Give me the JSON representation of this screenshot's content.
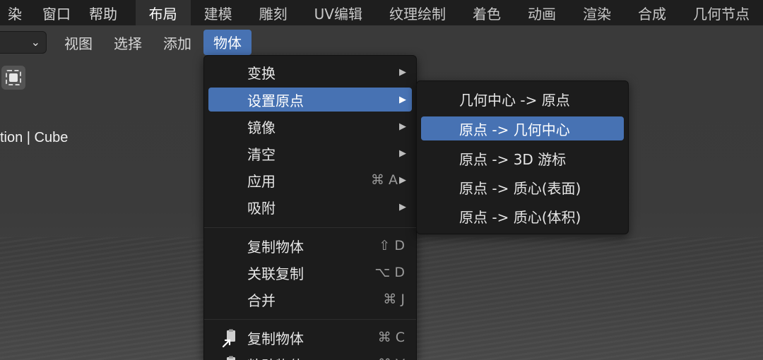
{
  "topbar": {
    "menus": [
      "染",
      "窗口",
      "帮助"
    ],
    "workspaces": [
      "布局",
      "建模",
      "雕刻",
      "UV编辑",
      "纹理绘制",
      "着色",
      "动画",
      "渲染",
      "合成",
      "几何节点"
    ],
    "active_workspace": "布局"
  },
  "viewport": {
    "header_menus": [
      "视图",
      "选择",
      "添加",
      "物体"
    ],
    "active_menu": "物体",
    "object_info": "tion | Cube"
  },
  "object_menu": {
    "items": [
      {
        "label": "变换",
        "shortcut": "",
        "submenu": true
      },
      {
        "label": "设置原点",
        "shortcut": "",
        "submenu": true,
        "highlighted": true
      },
      {
        "label": "镜像",
        "shortcut": "",
        "submenu": true
      },
      {
        "label": "清空",
        "shortcut": "",
        "submenu": true
      },
      {
        "label": "应用",
        "shortcut": "⌘ A",
        "submenu": true
      },
      {
        "label": "吸附",
        "shortcut": "",
        "submenu": true
      },
      {
        "label": "复制物体",
        "shortcut": "⇧ D"
      },
      {
        "label": "关联复制",
        "shortcut": "⌥ D"
      },
      {
        "label": "合并",
        "shortcut": "⌘ J"
      },
      {
        "label": "复制物体",
        "shortcut": "⌘ C",
        "icon": "copy-icon"
      },
      {
        "label": "粘贴物体",
        "shortcut": "⌘ V",
        "icon": "paste-icon"
      }
    ]
  },
  "origin_submenu": {
    "items": [
      {
        "label": "几何中心 -> 原点"
      },
      {
        "label": "原点 -> 几何中心",
        "highlighted": true
      },
      {
        "label": "原点 -> 3D 游标"
      },
      {
        "label": "原点 -> 质心(表面)"
      },
      {
        "label": "原点 -> 质心(体积)"
      }
    ]
  },
  "colors": {
    "accent": "#4772b3",
    "menu_bg": "#1c1c1c",
    "topbar_bg": "#1e1e1e",
    "viewport_bg": "#3b3b3b"
  },
  "icons": {
    "dropdown": "chevron-down-icon",
    "submenu": "triangle-right-icon",
    "tool": "select-box-icon"
  }
}
